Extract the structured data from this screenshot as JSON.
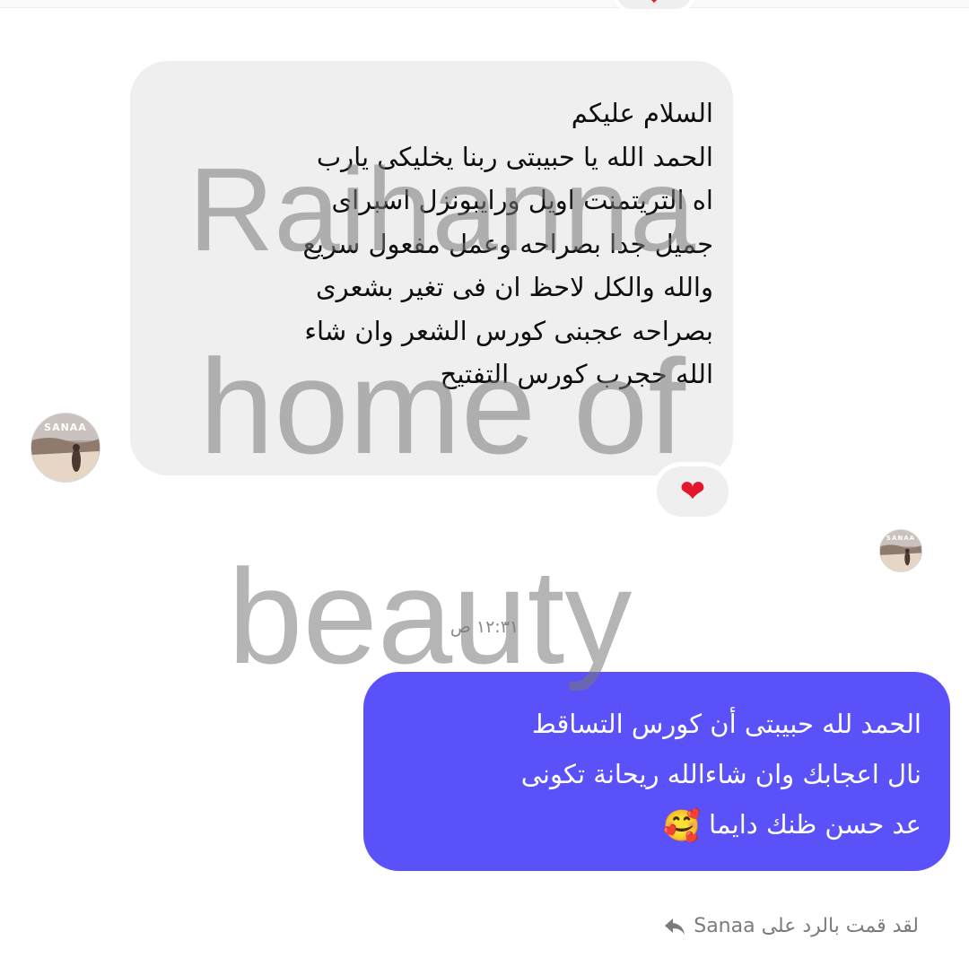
{
  "incoming_message": {
    "lines": [
      "السلام عليكم",
      "الحمد الله يا حبيبتى ربنا يخليكى يارب",
      "اه التريتمنت اويل ورايبونزل اسبراى",
      "جميل جدا بصراحه وعمل مفعول سريع",
      "والله والكل لاحظ ان فى تغير بشعرى",
      "بصراحه عجبنى كورس الشعر وان شاء",
      "الله حجرب كورس التفتيح"
    ],
    "reaction": "❤"
  },
  "top_reaction": "❤",
  "avatar_label": "SANAA",
  "timestamp": "١٢:٣١ ص",
  "outgoing_message": {
    "lines": [
      "الحمد لله حبيبتى أن كورس التساقط",
      "نال اعجابك وان شاءالله ريحانة تكونى",
      "عد حسن ظنك دايما"
    ],
    "emoji": "🥰"
  },
  "reply_note": "لقد قمت بالرد على Sanaa",
  "watermark": {
    "line1": "Raihanna",
    "line2": "home of",
    "line3": "beauty"
  },
  "colors": {
    "incoming_bubble": "#efefef",
    "outgoing_bubble": "#5b51f8",
    "heart": "#e2192c"
  }
}
